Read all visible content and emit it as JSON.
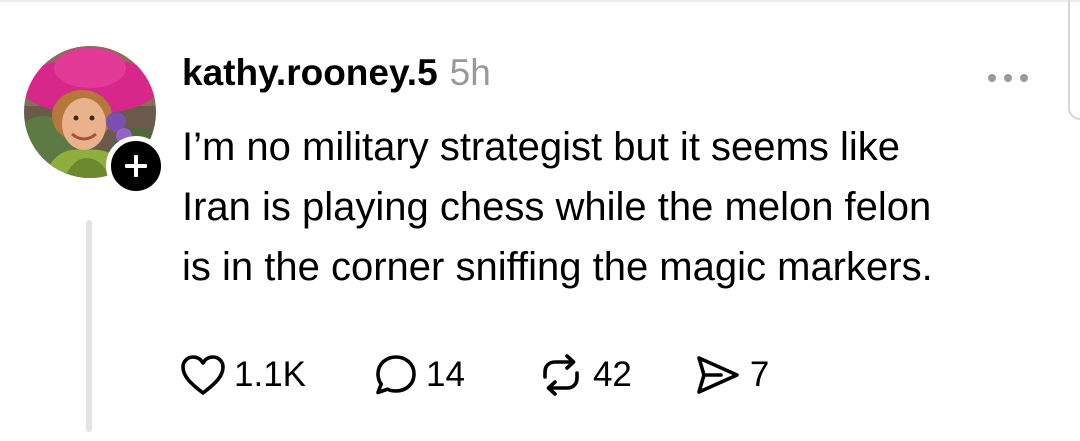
{
  "post": {
    "username": "kathy.rooney.5",
    "timestamp": "5h",
    "text": "I’m no military strategist but it seems like\nIran is playing chess while the melon felon\nis in the corner sniffing the magic markers.",
    "avatar_icon": "profile-photo",
    "follow_badge_icon": "plus-icon",
    "more_icon": "ellipsis-icon"
  },
  "actions": {
    "like": {
      "icon": "heart-icon",
      "count": "1.1K"
    },
    "reply": {
      "icon": "comment-icon",
      "count": "14"
    },
    "repost": {
      "icon": "repost-icon",
      "count": "42"
    },
    "share": {
      "icon": "send-icon",
      "count": "7"
    }
  }
}
